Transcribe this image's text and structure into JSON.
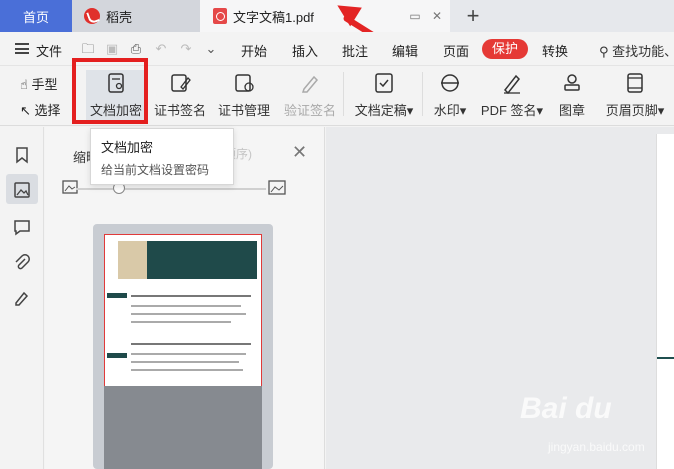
{
  "tabs": {
    "home": "首页",
    "daoke": "稻壳",
    "document": "文字文稿1.pdf",
    "new_tab": "+"
  },
  "menu": {
    "file": "文件",
    "items": [
      "开始",
      "插入",
      "批注",
      "编辑",
      "页面",
      "保护",
      "转换"
    ],
    "search": "查找功能、"
  },
  "ribbon": {
    "hand": "手型",
    "select": "选择",
    "buttons": [
      "文档加密",
      "证书签名",
      "证书管理",
      "验证签名",
      "文档定稿",
      "水印",
      "PDF 签名",
      "图章",
      "页眉页脚"
    ]
  },
  "panel": {
    "title": "缩略图",
    "ghost": "(按住拖拽调整顺序)"
  },
  "tooltip": {
    "title": "文档加密",
    "desc": "给当前文档设置密码"
  },
  "watermark": {
    "brand": "Bai du",
    "url": "jingyan.baidu.com"
  },
  "colors": {
    "accent": "#4a6fd8",
    "protect": "#e53935",
    "highlight": "#e41f1f"
  }
}
